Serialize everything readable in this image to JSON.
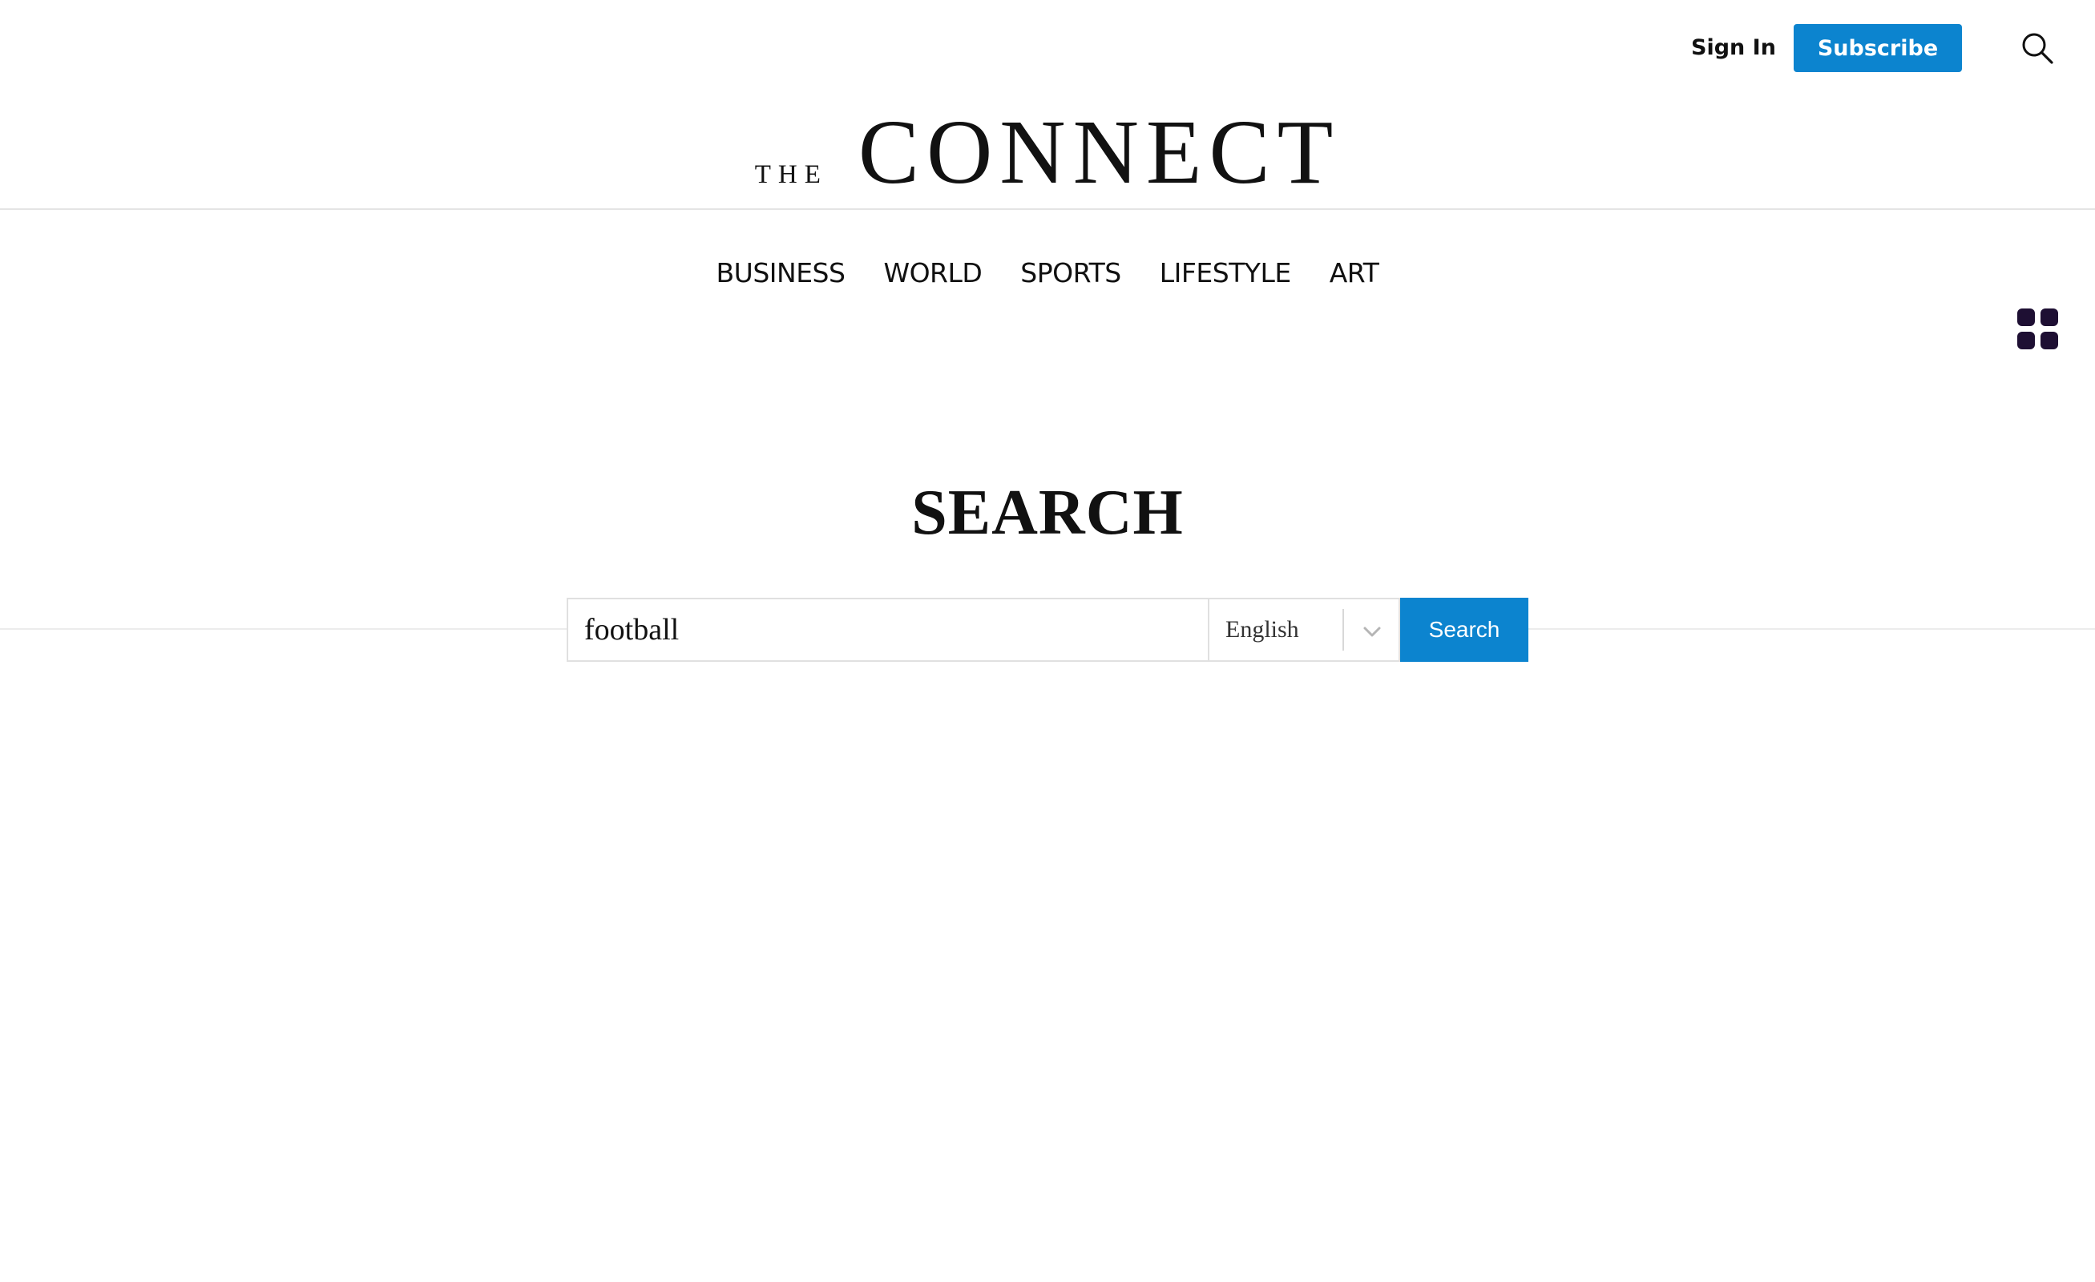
{
  "header": {
    "sign_in_label": "Sign In",
    "subscribe_label": "Subscribe",
    "search_icon": "search-icon",
    "accent_color": "#0c84cf"
  },
  "masthead": {
    "logo_prefix": "THE",
    "logo_name": "CONNECT"
  },
  "nav": {
    "items": [
      {
        "label": "BUSINESS"
      },
      {
        "label": "WORLD"
      },
      {
        "label": "SPORTS"
      },
      {
        "label": "LIFESTYLE"
      },
      {
        "label": "ART"
      }
    ],
    "apps_icon": "apps-grid-icon",
    "apps_icon_color": "#1e0f33"
  },
  "search": {
    "title": "SEARCH",
    "query_value": "football",
    "language_selected": "English",
    "submit_label": "Search"
  }
}
